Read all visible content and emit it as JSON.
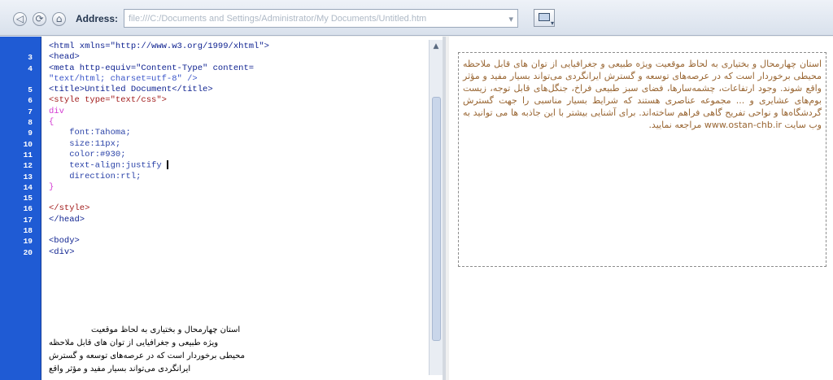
{
  "toolbar": {
    "back_glyph": "◁",
    "refresh_glyph": "⟳",
    "home_glyph": "⌂",
    "address_label": "Address:",
    "address_value": "file:///C:/Documents and Settings/Administrator/My Documents/Untitled.htm",
    "go_glyph": "▾",
    "view_icon": "preview-icon"
  },
  "code_view": {
    "line_numbers": [
      "",
      "3",
      "4",
      "",
      "5",
      "6",
      "7",
      "8",
      "9",
      "10",
      "11",
      "12",
      "13",
      "14",
      "15",
      "16",
      "17",
      "18",
      "19",
      "20"
    ],
    "lines": [
      "<html xmlns=\"http://www.w3.org/1999/xhtml\">",
      "<head>",
      "<meta http-equiv=\"Content-Type\" content=",
      "\"text/html; charset=utf-8\" />",
      "<title>Untitled Document</title>",
      "<style type=\"text/css\">",
      "div",
      "{",
      "    font:Tahoma;",
      "    size:11px;",
      "    color:#930;",
      "    text-align:justify ",
      "    direction:rtl;",
      "}",
      "",
      "</style>",
      "</head>",
      "",
      "<body>",
      "<div>"
    ],
    "body_text_lines": [
      "استان چهارمحال و بختیاری به لحاظ موقعیت",
      "ویژه طبیعی و جغرافیایی از توان های قابل ملاحظه",
      "محیطی برخوردار است که در عرصه‌های توسعه و گسترش",
      "ایرانگردی می‌تواند بسیار مفید و مؤثر واقع"
    ]
  },
  "design_view": {
    "paragraph": "استان چهارمحال و بختیاری به لحاظ موقعیت ویژه طبیعی و جغرافیایی از توان های قابل ملاحظه محیطی برخوردار است که در عرصه‌های توسعه و گسترش ایرانگردی می‌تواند بسیار مفید و مؤثر واقع شوند. وجود ارتفاعات، چشمه‌سارها، فضای سبز طبیعی فراخ، جنگل‌های قابل توجه، زیست بوم‌های عشایری و ... مجموعه عناصری هستند که شرایط بسیار مناسبی را جهت گسترش گردشگاه‌ها و نواحی تفریح گاهی فراهم ساخته‌اند. برای آشنایی بیشتر با این جاذبه ها می توانید به وب سایت www.ostan-chb.ir مراجعه نمایید.",
    "text_color": "#996633"
  },
  "colors": {
    "gutter": "#1f5bd4",
    "tag": "#0b1f8f",
    "attribute": "#a11b1b",
    "string": "#3a55c9",
    "selector": "#d33bd2"
  }
}
